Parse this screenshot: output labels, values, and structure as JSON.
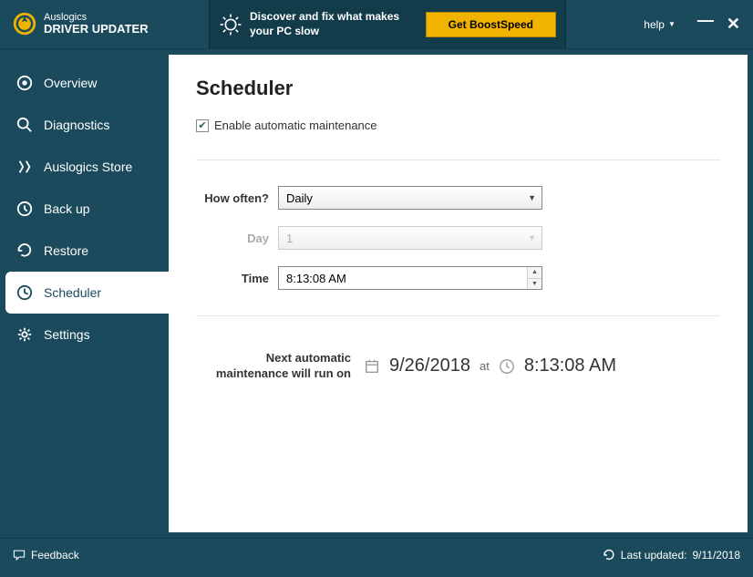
{
  "header": {
    "brand_line1": "Auslogics",
    "brand_line2": "DRIVER UPDATER",
    "promo_text": "Discover and fix what makes your PC slow",
    "boost_button": "Get BoostSpeed",
    "help_label": "help"
  },
  "sidebar": {
    "items": [
      {
        "label": "Overview"
      },
      {
        "label": "Diagnostics"
      },
      {
        "label": "Auslogics Store"
      },
      {
        "label": "Back up"
      },
      {
        "label": "Restore"
      },
      {
        "label": "Scheduler"
      },
      {
        "label": "Settings"
      }
    ]
  },
  "main": {
    "title": "Scheduler",
    "checkbox_label": "Enable automatic maintenance",
    "checkbox_checked": true,
    "labels": {
      "how_often": "How often?",
      "day": "Day",
      "time": "Time"
    },
    "values": {
      "how_often": "Daily",
      "day": "1",
      "time": "8:13:08 AM"
    },
    "next_label": "Next automatic maintenance will run on",
    "next_date": "9/26/2018",
    "next_at": "at",
    "next_time": "8:13:08 AM"
  },
  "footer": {
    "feedback": "Feedback",
    "last_updated_label": "Last updated:",
    "last_updated_value": "9/11/2018"
  }
}
